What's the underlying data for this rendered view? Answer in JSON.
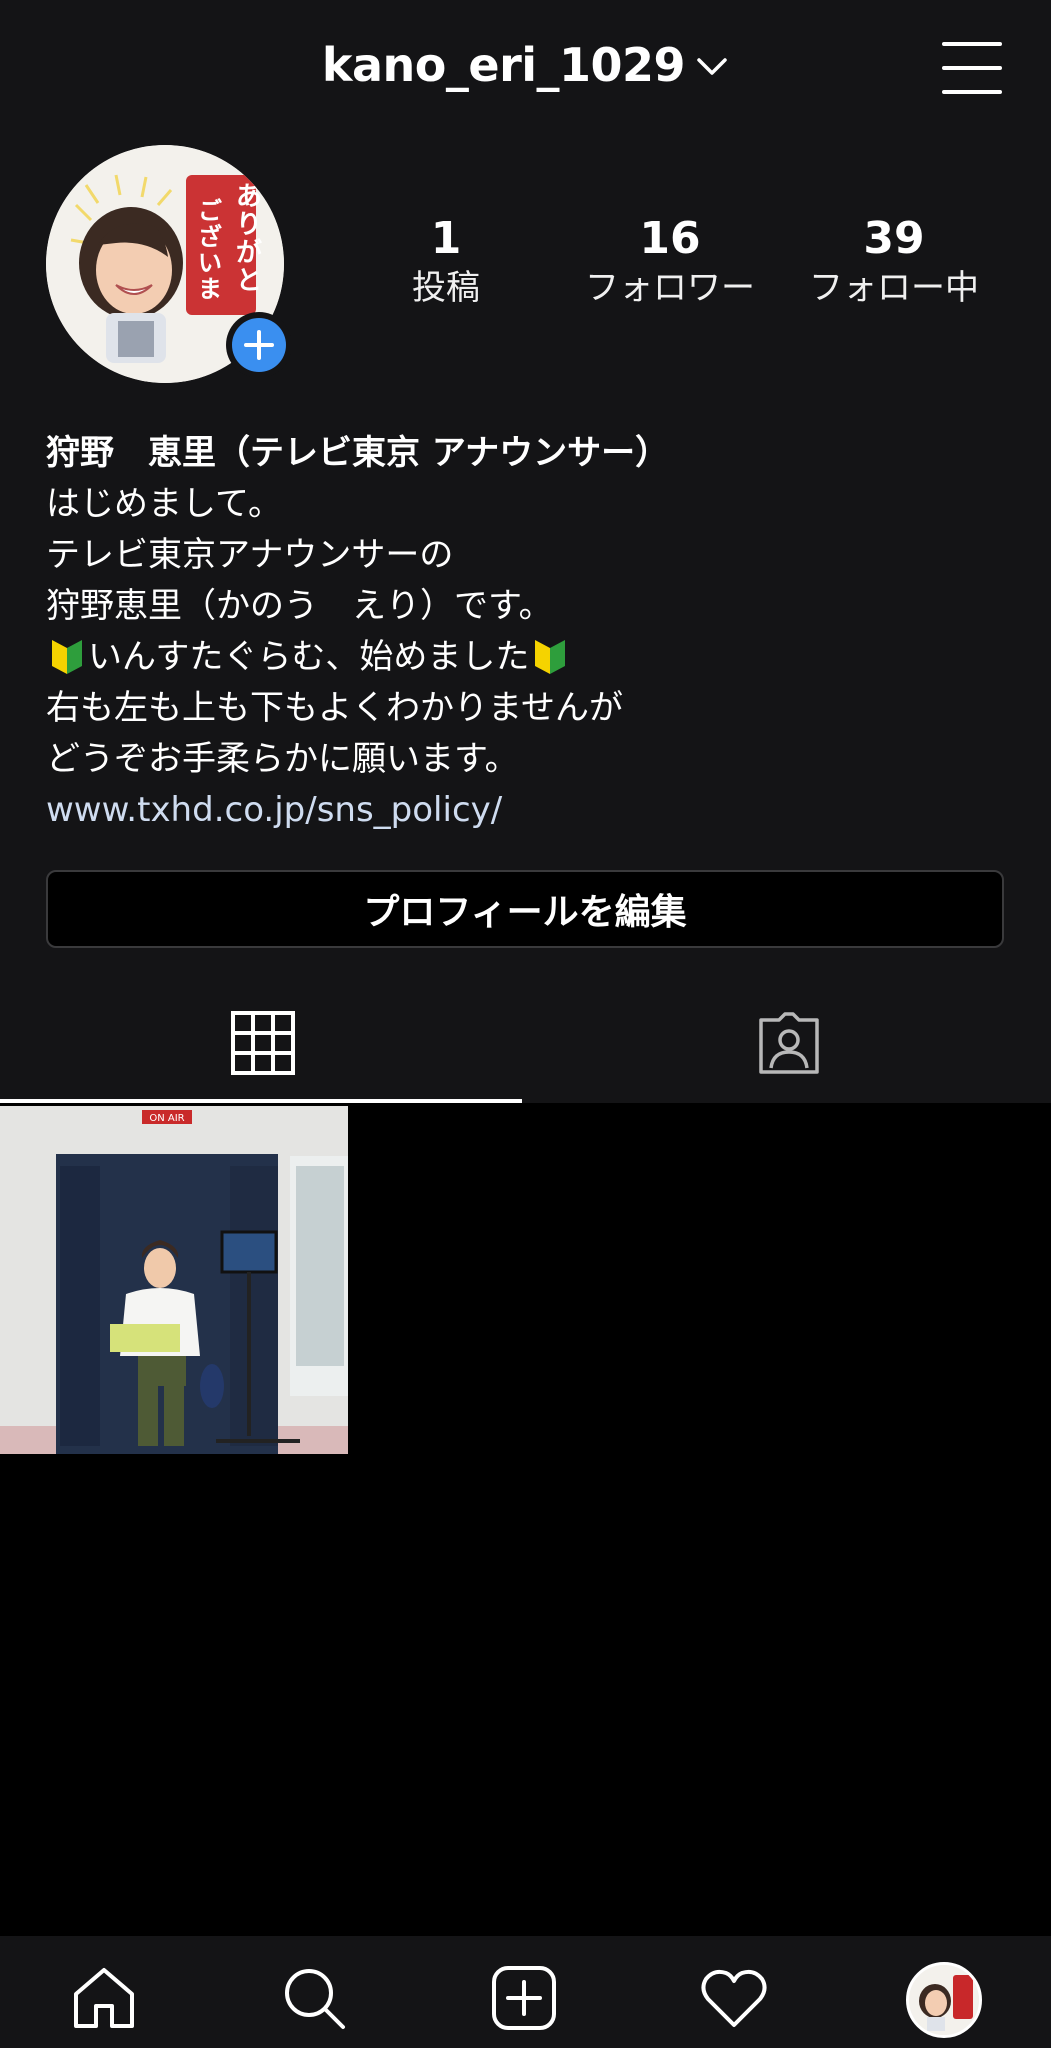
{
  "header": {
    "username": "kano_eri_1029",
    "username_icon": "chevron-down-icon",
    "menu_icon": "hamburger-menu-icon"
  },
  "profile": {
    "avatar_sticker_text": "ありがとうございます",
    "add_story_icon": "plus-icon",
    "stats": [
      {
        "value": "1",
        "label": "投稿"
      },
      {
        "value": "16",
        "label": "フォロワー"
      },
      {
        "value": "39",
        "label": "フォロー中"
      }
    ]
  },
  "bio": {
    "name": "狩野　恵里（テレビ東京 アナウンサー）",
    "line1": "はじめまして。",
    "line2": "テレビ東京アナウンサーの",
    "line3": "狩野恵里（かのう　えり）です。",
    "line4": "いんすたぐらむ、始めました",
    "line5": "右も左も上も下もよくわかりませんが",
    "line6": "どうぞお手柔らかに願います。",
    "link": "www.txhd.co.jp/sns_policy/"
  },
  "edit_profile_label": "プロフィールを編集",
  "tabs": [
    {
      "icon": "grid-icon",
      "active": true
    },
    {
      "icon": "tagged-person-icon",
      "active": false
    }
  ],
  "posts": [
    {
      "sign_text": "ON AIR"
    }
  ],
  "tabbar": [
    "home-icon",
    "search-icon",
    "new-post-icon",
    "heart-icon",
    "profile-avatar"
  ],
  "colors": {
    "background": "#141416",
    "accent_blue": "#3a8ff0",
    "link": "#cfdcf0"
  }
}
